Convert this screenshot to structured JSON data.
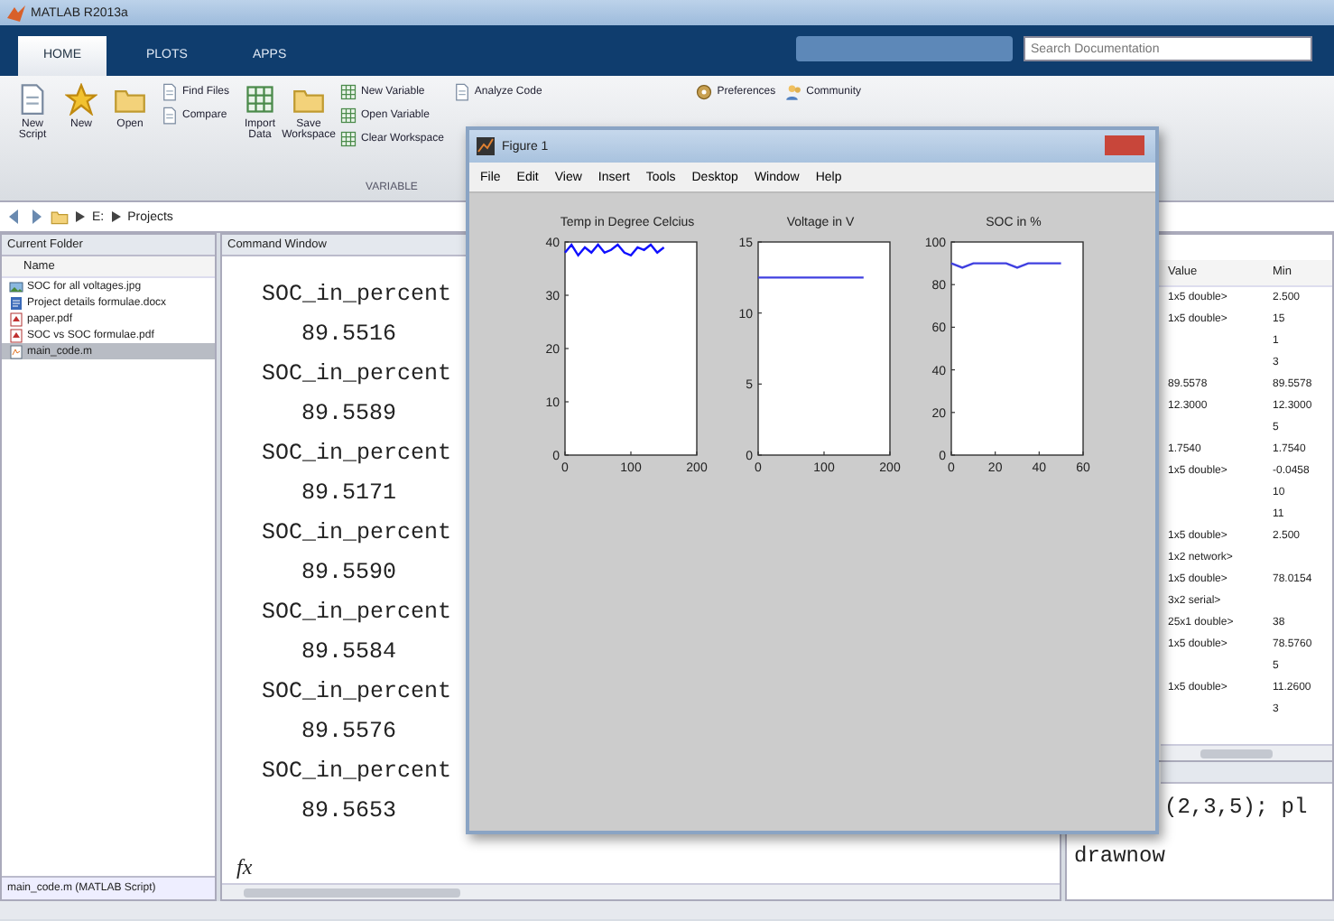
{
  "window": {
    "title": "MATLAB R2013a"
  },
  "tabs": [
    {
      "label": "HOME",
      "selected": true
    },
    {
      "label": "PLOTS",
      "selected": false
    },
    {
      "label": "APPS",
      "selected": false
    }
  ],
  "search": {
    "placeholder": "Search Documentation"
  },
  "toolstrip": {
    "groups": [
      {
        "kind": "large",
        "items": [
          {
            "label": "New Script"
          },
          {
            "label": "New"
          },
          {
            "label": "Open"
          }
        ]
      },
      {
        "kind": "small",
        "items": [
          {
            "label": "Find Files"
          },
          {
            "label": "Compare"
          }
        ]
      },
      {
        "kind": "large",
        "items": [
          {
            "label": "Import Data"
          },
          {
            "label": "Save Workspace"
          }
        ]
      },
      {
        "kind": "small",
        "label": "VARIABLE",
        "items": [
          {
            "label": "New Variable"
          },
          {
            "label": "Open Variable"
          },
          {
            "label": "Clear Workspace"
          }
        ]
      },
      {
        "kind": "small",
        "items": [
          {
            "label": "Analyze Code"
          }
        ]
      },
      {
        "kind": "small",
        "items": [
          {
            "label": "Preferences"
          }
        ]
      },
      {
        "kind": "small",
        "items": [
          {
            "label": "Community"
          }
        ]
      }
    ]
  },
  "address": {
    "crumbs": [
      "E:",
      "Projects"
    ]
  },
  "current_folder": {
    "title": "Current Folder",
    "column": "Name",
    "files": [
      {
        "name": "SOC for all voltages.jpg",
        "kind": "image",
        "selected": false
      },
      {
        "name": "Project details formulae.docx",
        "kind": "doc",
        "selected": false
      },
      {
        "name": "paper.pdf",
        "kind": "pdf",
        "selected": false
      },
      {
        "name": "SOC vs SOC formulae.pdf",
        "kind": "pdf",
        "selected": false
      },
      {
        "name": "main_code.m",
        "kind": "script",
        "selected": true
      }
    ],
    "details": "main_code.m (MATLAB Script)"
  },
  "command_window": {
    "title": "Command Window",
    "prompt": "fx",
    "entries": [
      {
        "name": "SOC_in_percent",
        "value": "89.5516"
      },
      {
        "name": "SOC_in_percent",
        "value": "89.5589"
      },
      {
        "name": "SOC_in_percent",
        "value": "89.5171"
      },
      {
        "name": "SOC_in_percent",
        "value": "89.5590"
      },
      {
        "name": "SOC_in_percent",
        "value": "89.5584"
      },
      {
        "name": "SOC_in_percent",
        "value": "89.5576"
      },
      {
        "name": "SOC_in_percent",
        "value": "89.5653"
      }
    ]
  },
  "figure": {
    "title": "Figure 1",
    "menu": [
      "File",
      "Edit",
      "View",
      "Insert",
      "Tools",
      "Desktop",
      "Window",
      "Help"
    ],
    "plots": [
      {
        "chart_data": {
          "type": "line",
          "title": "Temp in Degree Celcius",
          "x": [
            0,
            10,
            20,
            30,
            40,
            50,
            60,
            70,
            80,
            90,
            100,
            110,
            120,
            130,
            140,
            150
          ],
          "series": [
            {
              "color": "#1010ff",
              "values": [
                38,
                39.5,
                37.5,
                39,
                38,
                39.5,
                38,
                38.5,
                39.5,
                38,
                37.5,
                39,
                38.5,
                39.5,
                38,
                39
              ]
            }
          ],
          "xlim": [
            0,
            200
          ],
          "ylim": [
            0,
            40
          ],
          "xticks": [
            0,
            100,
            200
          ],
          "yticks": [
            0,
            10,
            20,
            30,
            40
          ]
        }
      },
      {
        "chart_data": {
          "type": "line",
          "title": "Voltage in V",
          "x": [
            0,
            40,
            80,
            120,
            160
          ],
          "series": [
            {
              "color": "#4040e0",
              "values": [
                12.5,
                12.5,
                12.5,
                12.5,
                12.5
              ]
            }
          ],
          "xlim": [
            0,
            200
          ],
          "ylim": [
            0,
            15
          ],
          "xticks": [
            0,
            100,
            200
          ],
          "yticks": [
            0,
            5,
            10,
            15
          ]
        }
      },
      {
        "chart_data": {
          "type": "line",
          "title": "SOC in %",
          "x": [
            0,
            5,
            10,
            15,
            20,
            25,
            30,
            35,
            40,
            45,
            50
          ],
          "series": [
            {
              "color": "#4040e0",
              "values": [
                90,
                88,
                90,
                90,
                90,
                90,
                88,
                90,
                90,
                90,
                90
              ]
            }
          ],
          "xlim": [
            0,
            60
          ],
          "ylim": [
            0,
            100
          ],
          "xticks": [
            0,
            20,
            40,
            60
          ],
          "yticks": [
            0,
            20,
            40,
            60,
            80,
            100
          ]
        }
      }
    ]
  },
  "workspace": {
    "columns": [
      "Value",
      "Min"
    ],
    "rows": [
      {
        "value": "1x5 double>",
        "min": "2.500"
      },
      {
        "value": "1x5 double>",
        "min": "15"
      },
      {
        "min": "1"
      },
      {
        "min": "3"
      },
      {
        "value": "89.5578",
        "min": "89.5578"
      },
      {
        "value": "12.3000",
        "min": "12.3000"
      },
      {
        "min": "5"
      },
      {
        "value": "1.7540",
        "min": "1.7540"
      },
      {
        "value": "1x5 double>",
        "min": "-0.0458"
      },
      {
        "min": "10"
      },
      {
        "min": "11"
      },
      {
        "value": "1x5 double>",
        "min": "2.500"
      },
      {
        "value": "1x2 network>"
      },
      {
        "value": "1x5 double>",
        "min": "78.0154"
      },
      {
        "value": "3x2 serial>"
      },
      {
        "value": "25x1 double>",
        "min": "38"
      },
      {
        "value": "1x5 double>",
        "min": "78.5760"
      },
      {
        "min": "5"
      },
      {
        "value": "1x5 double>",
        "min": "11.2600"
      },
      {
        "min": "3"
      }
    ]
  },
  "command_history": {
    "lines": [
      "(2,3,5); pl",
      "drawnow"
    ]
  }
}
